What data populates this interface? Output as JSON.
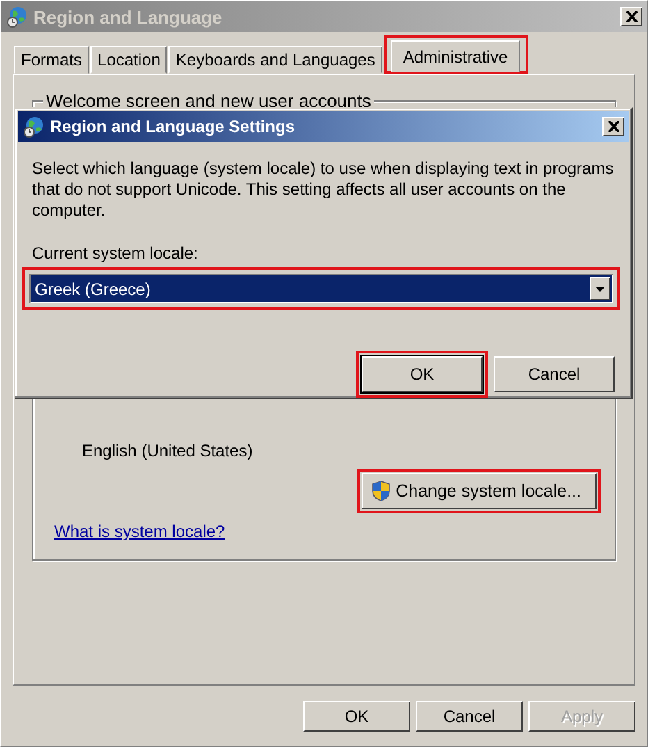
{
  "window": {
    "title": "Region and Language",
    "active": false
  },
  "tabs": [
    {
      "label": "Formats",
      "selected": false,
      "highlighted": false
    },
    {
      "label": "Location",
      "selected": false,
      "highlighted": false
    },
    {
      "label": "Keyboards and Languages",
      "selected": false,
      "highlighted": false
    },
    {
      "label": "Administrative",
      "selected": true,
      "highlighted": true
    }
  ],
  "welcome_group": {
    "title": "Welcome screen and new user accounts"
  },
  "non_unicode_group": {
    "current_language": "English (United States)",
    "change_button": {
      "label": "Change system locale...",
      "highlighted": true
    },
    "help_link": "What is system locale?"
  },
  "buttons": [
    {
      "label": "OK",
      "disabled": false
    },
    {
      "label": "Cancel",
      "disabled": false
    },
    {
      "label": "Apply",
      "disabled": true
    }
  ],
  "dialog": {
    "title": "Region and Language Settings",
    "active": true,
    "description": "Select which language (system locale) to use when displaying text in programs that do not support Unicode. This setting affects all user accounts on the computer.",
    "locale_label": "Current system locale:",
    "locale_select": {
      "value": "Greek (Greece)",
      "highlighted": true
    },
    "buttons": [
      {
        "label": "OK",
        "default": true,
        "highlighted": true
      },
      {
        "label": "Cancel",
        "default": false,
        "highlighted": false
      }
    ]
  }
}
